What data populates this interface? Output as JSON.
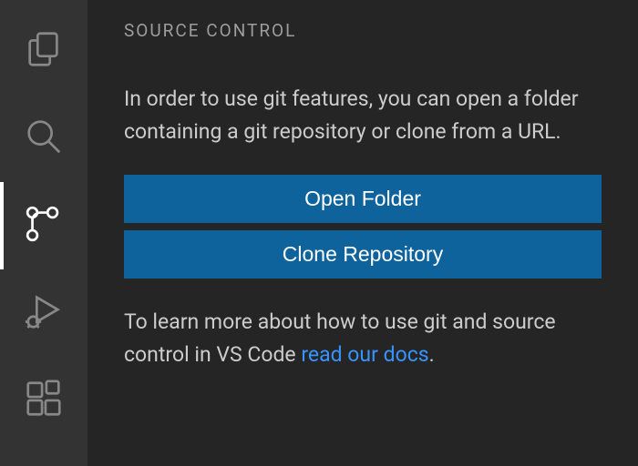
{
  "sidebar": {
    "title": "SOURCE CONTROL",
    "intro": "In order to use git features, you can open a folder containing a git repository or clone from a URL.",
    "open_folder_label": "Open Folder",
    "clone_label": "Clone Repository",
    "help_prefix": "To learn more about how to use git and source control in VS Code ",
    "help_link": "read our docs",
    "help_suffix": "."
  },
  "activitybar": {
    "items": [
      {
        "name": "explorer-icon"
      },
      {
        "name": "search-icon"
      },
      {
        "name": "source-control-icon"
      },
      {
        "name": "run-debug-icon"
      },
      {
        "name": "extensions-icon"
      }
    ]
  },
  "colors": {
    "accent": "#0e639c",
    "link": "#3794ff"
  }
}
